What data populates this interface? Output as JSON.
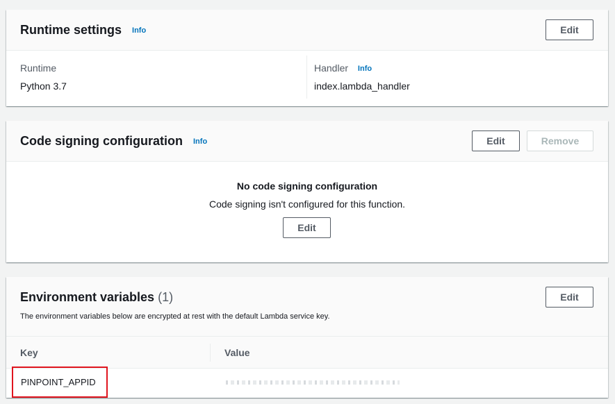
{
  "runtime_settings": {
    "title": "Runtime settings",
    "info": "Info",
    "edit": "Edit",
    "runtime_label": "Runtime",
    "runtime_value": "Python 3.7",
    "handler_label": "Handler",
    "handler_info": "Info",
    "handler_value": "index.lambda_handler"
  },
  "code_signing": {
    "title": "Code signing configuration",
    "info": "Info",
    "edit": "Edit",
    "remove": "Remove",
    "empty_title": "No code signing configuration",
    "empty_desc": "Code signing isn't configured for this function.",
    "empty_edit": "Edit"
  },
  "env_vars": {
    "title": "Environment variables",
    "count": "(1)",
    "edit": "Edit",
    "description": "The environment variables below are encrypted at rest with the default Lambda service key.",
    "columns": {
      "key": "Key",
      "value": "Value"
    },
    "rows": [
      {
        "key": "PINPOINT_APPID",
        "value": ""
      }
    ]
  },
  "colors": {
    "accent_link": "#0073bb",
    "highlight_border": "#e0141e"
  }
}
